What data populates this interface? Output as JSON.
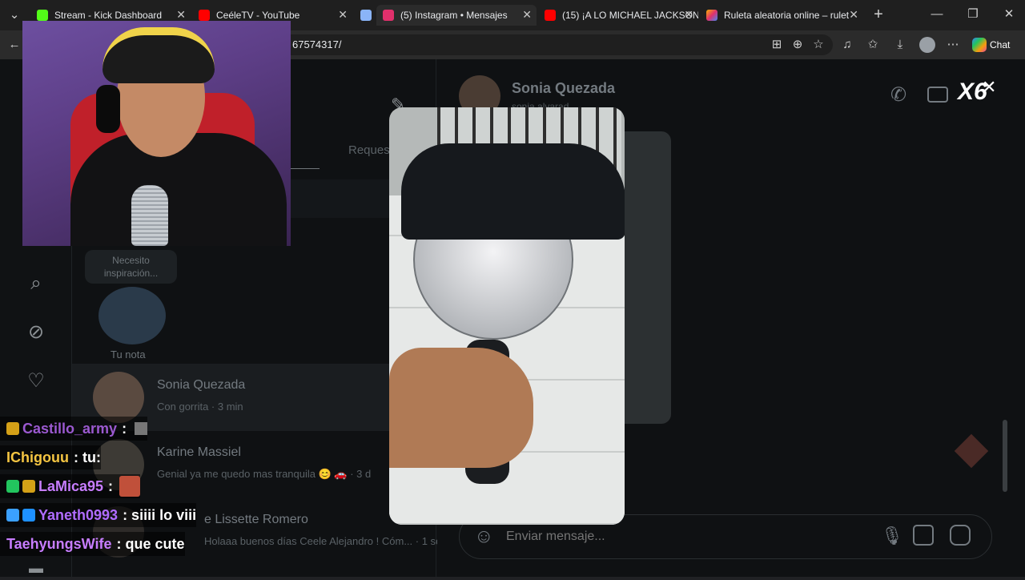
{
  "tabs": [
    {
      "title": "Stream - Kick Dashboard",
      "color": "#53fc18"
    },
    {
      "title": "CeéleTV - YouTube",
      "color": "#ff0000"
    },
    {
      "title": "",
      "color": "#8ab4f8"
    },
    {
      "title": "(5) Instagram • Mensajes",
      "color": "#e1306c"
    },
    {
      "title": "(15) ¡A LO MICHAEL JACKSON",
      "color": "#ff0000"
    },
    {
      "title": "Ruleta aleatoria online – rulet",
      "color": "#f4b400"
    }
  ],
  "address": {
    "url": "67574317/"
  },
  "toolbar": {
    "chat_label": "Chat",
    "multiplier": "X6"
  },
  "sidebar_icons": [
    "search-icon",
    "compass-icon",
    "heart-icon"
  ],
  "notes": {
    "bubble": "Necesito inspiración...",
    "my_note": "Tu nota",
    "requests_tab": "Reques"
  },
  "conversations": [
    {
      "name": "Sonia Quezada",
      "preview": "Con gorrita · 3 min"
    },
    {
      "name": "Karine Massiel",
      "preview": "Genial ya me quedo mas tranquila 😊 🚗 · 3 d"
    },
    {
      "name": "e Lissette Romero",
      "preview": "Holaaa buenos días Ceele Alejandro ! Cóm... · 1 sem"
    }
  ],
  "chat_header": {
    "name": "Sonia Quezada",
    "username": "sonia.alvarad"
  },
  "composer": {
    "placeholder": "Enviar mensaje..."
  },
  "stream_chat": [
    {
      "user": "Castillo_army",
      "msg": ":",
      "color": "#9b59d0"
    },
    {
      "user": "IChigouu",
      "msg": ": tu:",
      "color": "#f5c542"
    },
    {
      "user": "LaMica95",
      "msg": ":",
      "color": "#c77dff"
    },
    {
      "user": "Yaneth0993",
      "msg": ": siiii lo viii",
      "color": "#b06cff"
    },
    {
      "user": "TaehyungsWife",
      "msg": ": que cute",
      "color": "#c77dff"
    }
  ]
}
